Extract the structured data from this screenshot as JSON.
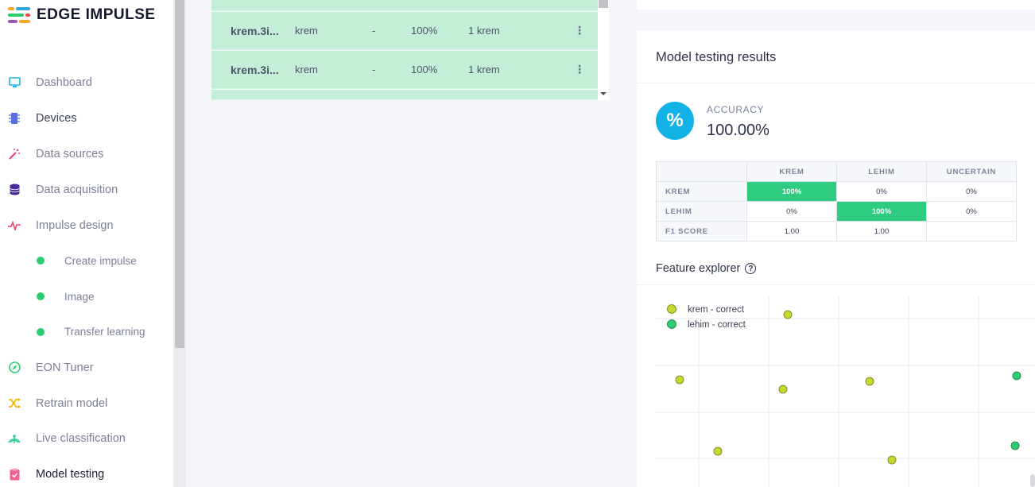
{
  "app": {
    "brand": "EDGE IMPULSE",
    "colors": {
      "accent_blue": "#13b2e6",
      "success_green": "#2ecc80",
      "row_green": "#c3efd9"
    }
  },
  "sidebar": {
    "items": [
      {
        "label": "Dashboard",
        "icon": "monitor-icon"
      },
      {
        "label": "Devices",
        "icon": "chip-icon"
      },
      {
        "label": "Data sources",
        "icon": "magic-wand-icon"
      },
      {
        "label": "Data acquisition",
        "icon": "database-icon"
      },
      {
        "label": "Impulse design",
        "icon": "pulse-icon"
      },
      {
        "label": "Create impulse",
        "icon": "dot-icon"
      },
      {
        "label": "Image",
        "icon": "dot-icon"
      },
      {
        "label": "Transfer learning",
        "icon": "dot-icon"
      },
      {
        "label": "EON Tuner",
        "icon": "compass-icon"
      },
      {
        "label": "Retrain model",
        "icon": "shuffle-icon"
      },
      {
        "label": "Live classification",
        "icon": "signal-icon"
      },
      {
        "label": "Model testing",
        "icon": "clipboard-check-icon"
      }
    ]
  },
  "samples": {
    "rows": [
      {
        "name": "krem.3i...",
        "label": "krem",
        "dash": "-",
        "accuracy": "100%",
        "result": "1 krem"
      },
      {
        "name": "krem.3i...",
        "label": "krem",
        "dash": "-",
        "accuracy": "100%",
        "result": "1 krem"
      }
    ]
  },
  "results": {
    "title": "Model testing results",
    "accuracy_label": "ACCURACY",
    "accuracy_value": "100.00%",
    "accuracy_symbol": "%",
    "matrix": {
      "columns": [
        "KREM",
        "LEHIM",
        "UNCERTAIN"
      ],
      "rows": [
        {
          "label": "KREM",
          "cells": [
            "100%",
            "0%",
            "0%"
          ]
        },
        {
          "label": "LEHIM",
          "cells": [
            "0%",
            "100%",
            "0%"
          ]
        },
        {
          "label": "F1 SCORE",
          "cells": [
            "1.00",
            "1.00",
            ""
          ]
        }
      ]
    },
    "feature_explorer_title": "Feature explorer",
    "legend": [
      {
        "label": "krem - correct",
        "color": "#c4d82e"
      },
      {
        "label": "lehim - correct",
        "color": "#2ecc71"
      }
    ]
  }
}
